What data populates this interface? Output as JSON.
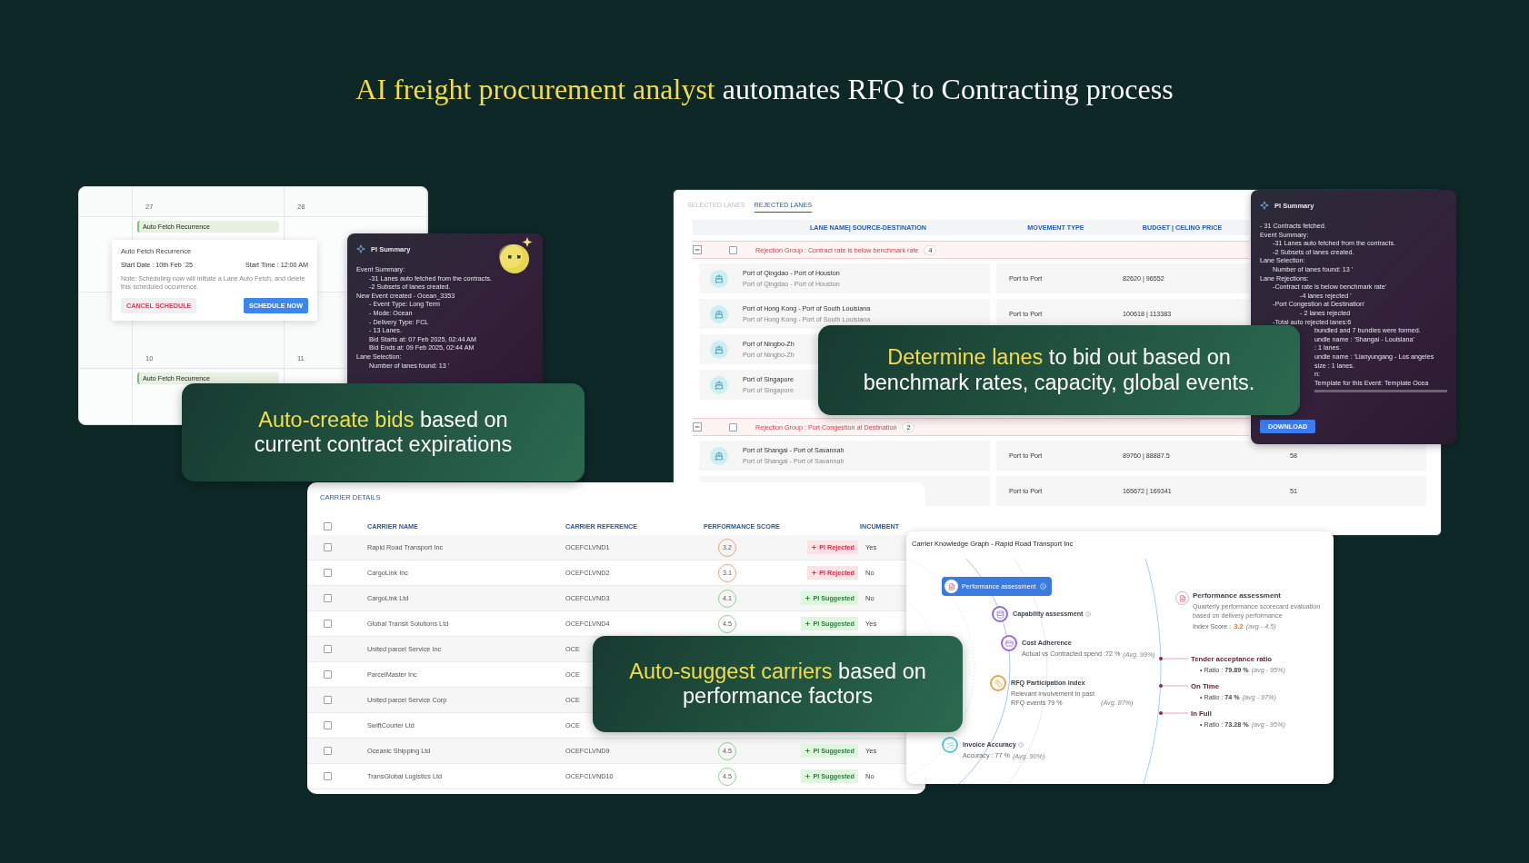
{
  "title": {
    "highlight": "AI freight procurement analyst",
    "text": "automates RFQ to Contracting process"
  },
  "calendar": {
    "weeks": [
      {
        "days": [
          {
            "day": "27",
            "event": "Auto Fetch Recurrence"
          },
          {
            "day": "28"
          }
        ]
      },
      {
        "days": [
          {
            "day": "10",
            "event": "Auto Fetch Recurrence"
          },
          {
            "day": "11"
          }
        ]
      }
    ],
    "popup": {
      "title": "Auto Fetch Recurrence",
      "start_date": "Start Date : 10th Feb `25",
      "start_time": "Start Time : 12:00 AM",
      "note": "Note: Scheduling now will initiate a Lane Auto Fetch, and delete this scheduled occurrence.",
      "buttons": [
        {
          "label": "CANCEL SCHEDULE",
          "kind": "secondary"
        },
        {
          "label": "SCHEDULE NOW",
          "kind": "primary"
        }
      ]
    }
  },
  "bid_summary": {
    "title": "PI Summary",
    "lines": [
      {
        "kind": "heading",
        "text": "Event Summary:"
      },
      {
        "kind": "item",
        "text": "-31 Lanes auto fetched from the contracts."
      },
      {
        "kind": "item",
        "text": "-2 Subsets of lanes created."
      },
      {
        "kind": "heading",
        "text": "New Event created - Ocean_3353"
      },
      {
        "kind": "item",
        "text": "- Event Type: Long Term"
      },
      {
        "kind": "item",
        "text": "- Mode: Ocean"
      },
      {
        "kind": "item",
        "text": "- Delivery Type: FCL"
      },
      {
        "kind": "item",
        "text": "- 13 Lanes."
      },
      {
        "kind": "item",
        "text": "Bid Starts at: 07 Feb 2025, 02:44 AM"
      },
      {
        "kind": "item",
        "text": "Bid Ends at: 09 Feb 2025, 02:44 AM"
      },
      {
        "kind": "heading",
        "text": "Lane Selection:"
      },
      {
        "kind": "item",
        "text": "Number of lanes found: 13 '"
      }
    ]
  },
  "banners": [
    {
      "highlight": "Auto-create bids",
      "text": "based on current contract expirations"
    },
    {
      "highlight": "Determine lanes",
      "text": "to bid out based on benchmark rates, capacity, global events."
    },
    {
      "highlight": "Auto-suggest carriers",
      "text": "based on performance factors"
    }
  ],
  "lanes": {
    "tabs": [
      {
        "label": "SELECTED LANES",
        "selected": false
      },
      {
        "label": "REJECTED LANES",
        "selected": true
      }
    ],
    "columns": [
      "LANE NAME| SOURCE-DESTINATION",
      "MOVEMENT TYPE",
      "BUDGET | CELING PRICE"
    ],
    "groups": [
      {
        "label": "Rejection Group : Contract rate is below benchmark rate",
        "count": "4",
        "expanded": true,
        "checked": false,
        "lanes": [
          {
            "name": "Port of Qingdao - Port of Houston",
            "route": "Port of Qingdao - Port of Houston",
            "movement": "Port to Port",
            "budget": "82620 | 96552"
          },
          {
            "name": "Port of Hong Kong - Port of South Louisiana",
            "route": "Port of Hong Kong - Port of South Louisiana",
            "movement": "Port to Port",
            "budget": "100618 | 113383"
          },
          {
            "name": "Port of Ningbo-Zh",
            "route": "Port of Ningbo-Zh"
          },
          {
            "name": "Port of Singapore",
            "route": "Port of Singapore"
          }
        ]
      },
      {
        "label": "Rejection Group : Port Congestion at Destination",
        "count": "2",
        "expanded": true,
        "checked": false,
        "lanes": [
          {
            "name": "Port of Shangai - Port of Savannah",
            "route": "Port of Shangai - Port of Savannah",
            "movement": "Port to Port",
            "budget": "89760 | 88887.5",
            "column_4": "58"
          },
          {
            "movement": "Port to Port",
            "budget": "165672 | 169341",
            "column_4": "51"
          }
        ]
      }
    ]
  },
  "lane_summary": {
    "title": "PI Summary",
    "download": "DOWNLOAD",
    "lines": [
      {
        "kind": "heading",
        "text": "- 31 Contracts fetched."
      },
      {
        "kind": "heading",
        "text": "Event Summary:"
      },
      {
        "kind": "item",
        "text": "-31 Lanes auto fetched from the contracts."
      },
      {
        "kind": "item",
        "text": "-2 Subsets of lanes created."
      },
      {
        "kind": "heading",
        "text": "Lane Selection:"
      },
      {
        "kind": "item",
        "text": "Number of lanes found: 13 '"
      },
      {
        "kind": "heading",
        "text": "Lane Rejections:"
      },
      {
        "kind": "item",
        "text": "-Contract rate is below benchmark rate'"
      },
      {
        "kind": "subitem",
        "text": "-4 lanes rejected '"
      },
      {
        "kind": "item",
        "text": "-Port Congestion at Destination'"
      },
      {
        "kind": "subitem",
        "text": "- 2 lanes rejected"
      },
      {
        "kind": "item",
        "text": "-Total auto rejected lanes:6"
      },
      {
        "kind": "clipped",
        "text": "bundled and 7 bundles were formed."
      },
      {
        "kind": "clipped",
        "text": "undle name : 'Shangai - Louisiana'"
      },
      {
        "kind": "clipped",
        "text": ": 1 lanes."
      },
      {
        "kind": "clipped",
        "text": "undle name : 'Lianyungang - Los angeles"
      },
      {
        "kind": "clipped",
        "text": "size : 1 lanes."
      },
      {
        "kind": "clipped",
        "text": "n:"
      },
      {
        "kind": "clipped",
        "text": "Template for this Event: Template Ocea"
      }
    ]
  },
  "carriers": {
    "title": "CARRIER DETAILS",
    "header_checked": false,
    "columns": [
      "CARRIER NAME",
      "CARRIER REFERENCE",
      "PERFORMANCE SCORE",
      "INCUMBENT"
    ],
    "rows": [
      {
        "checked": false,
        "name": "Rapid Road Transport Inc",
        "reference": "OCEFCLVND1",
        "score": "3.2",
        "kind": "rejected",
        "badge": "PI Rejected",
        "incumbent": "Yes"
      },
      {
        "checked": false,
        "name": "CargoLink Inc",
        "reference": "OCEFCLVND2",
        "score": "3.1",
        "kind": "rejected",
        "badge": "PI Rejected",
        "incumbent": "No"
      },
      {
        "checked": false,
        "name": "CargoLink Ltd",
        "reference": "OCEFCLVND3",
        "score": "4.1",
        "kind": "suggested",
        "badge": "PI Suggested",
        "incumbent": "No"
      },
      {
        "checked": false,
        "name": "Global Transit Solutions Ltd",
        "reference": "OCEFCLVND4",
        "score": "4.5",
        "kind": "suggested",
        "badge": "PI Suggested",
        "incumbent": "Yes"
      },
      {
        "checked": false,
        "name": "United parcel Service Inc",
        "reference": "OCE"
      },
      {
        "checked": false,
        "name": "ParcelMaster Inc",
        "reference": "OCE"
      },
      {
        "checked": false,
        "name": "United parcel Service Corp",
        "reference": "OCE"
      },
      {
        "checked": false,
        "name": "SwiftCourier Ltd",
        "reference": "OCE"
      },
      {
        "checked": false,
        "name": "Oceanic Shipping Ltd",
        "reference": "OCEFCLVND9",
        "score": "4.5",
        "kind": "suggested",
        "badge": "PI Suggested",
        "incumbent": "Yes"
      },
      {
        "checked": false,
        "name": "TransGlobal Logistics Ltd",
        "reference": "OCEFCLVND10",
        "score": "4.5",
        "kind": "suggested",
        "badge": "PI Suggested",
        "incumbent": "No"
      }
    ]
  },
  "graph": {
    "title": "Carrier Knowledge Graph - Rapid Road Transport Inc",
    "nodes": [
      {
        "label": "Performance assessment",
        "selected": true,
        "info": true,
        "color": "#3b7be0"
      },
      {
        "label": "Capability assessment",
        "selected": false,
        "info": true,
        "color": "#8a6be0"
      },
      {
        "label": "Cost Adherence",
        "detail": "Actual vs Contracted spend :72 %",
        "avg": "(Avg. 99%)",
        "selected": false,
        "info": false,
        "color": "#9b6ae0"
      },
      {
        "label": "RFQ Participation index",
        "detail": "Relevant involvement in past RFQ events 79 %",
        "avg": "(Avg. 87%)",
        "selected": false,
        "info": false,
        "color": "#e0a84a"
      },
      {
        "label": "Invoice Accuracy",
        "detail": "Accuracy : 77 %",
        "avg": "(Avg. 90%)",
        "selected": false,
        "info": true,
        "color": "#5bc6d8"
      }
    ],
    "detail": {
      "title": "Performance assessment",
      "description": "Quarterly performance scorecard evaluation based on delivery performance",
      "index_label": "Index Score :",
      "index_value": "3.2",
      "index_avg": "(avg - 4.5)"
    },
    "metrics": [
      {
        "title": "Tender acceptance ratio",
        "ratio": "• Ratio : **79.89 %**",
        "avg": "(avg - 95%)"
      },
      {
        "title": "On Time",
        "ratio": "• Ratio : **74 %**",
        "avg": "(avg - 97%)"
      },
      {
        "title": "In Full",
        "ratio": "• Ratio : **73.28 %**",
        "avg": "(avg - 95%)"
      }
    ]
  }
}
